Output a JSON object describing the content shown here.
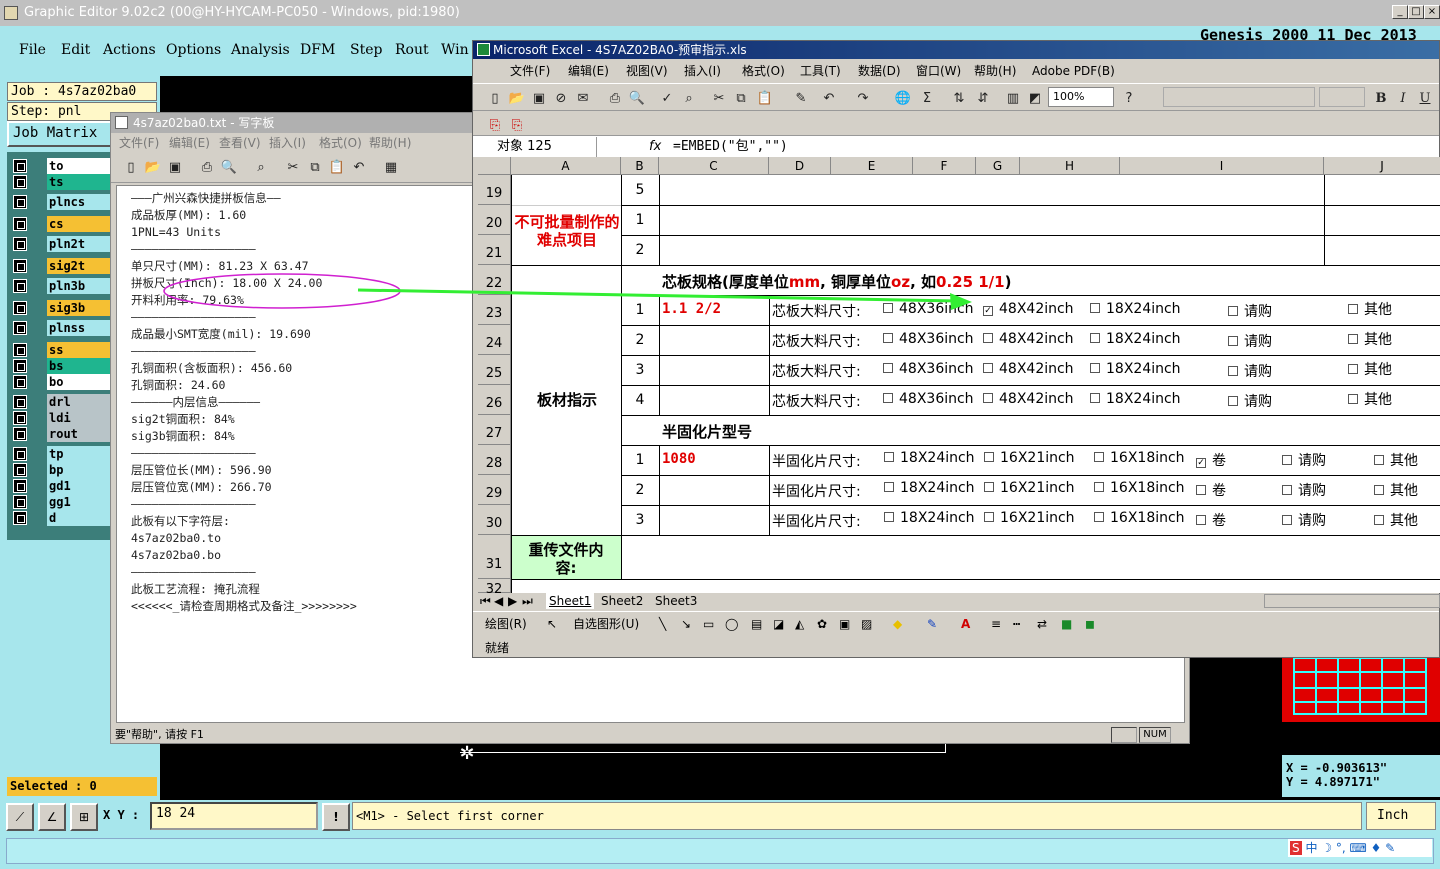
{
  "ge": {
    "title": "Graphic Editor 9.02c2 (00@HY-HYCAM-PC050 - Windows, pid:1980)",
    "menu": [
      "File",
      "Edit",
      "Actions",
      "Options",
      "Analysis",
      "DFM",
      "Step",
      "Rout",
      "Win"
    ],
    "job": "Job : 4s7az02ba0",
    "step": "Step: pnl",
    "job_matrix": "Job Matrix",
    "layers": [
      {
        "name": "to",
        "color": "#ffffff"
      },
      {
        "name": "ts",
        "color": "#1fb58f"
      },
      {
        "name": "plncs",
        "color": "#a7e6ec"
      },
      {
        "name": "cs",
        "color": "#f5c033"
      },
      {
        "name": "pln2t",
        "color": "#a7e6ec"
      },
      {
        "name": "sig2t",
        "color": "#f5c033"
      },
      {
        "name": "pln3b",
        "color": "#a7e6ec"
      },
      {
        "name": "sig3b",
        "color": "#f5c033"
      },
      {
        "name": "plnss",
        "color": "#a7e6ec"
      },
      {
        "name": "ss",
        "color": "#f5c033"
      },
      {
        "name": "bs",
        "color": "#1fb58f"
      },
      {
        "name": "bo",
        "color": "#ffffff"
      },
      {
        "name": "drl",
        "color": "#b8c4c8"
      },
      {
        "name": "ldi",
        "color": "#b8c4c8"
      },
      {
        "name": "rout",
        "color": "#b8c4c8"
      },
      {
        "name": "tp",
        "color": "#a7e6ec"
      },
      {
        "name": "bp",
        "color": "#a7e6ec"
      },
      {
        "name": "gd1",
        "color": "#a7e6ec"
      },
      {
        "name": "gg1",
        "color": "#a7e6ec"
      },
      {
        "name": "d",
        "color": "#a7e6ec"
      }
    ],
    "selected": "Selected : 0",
    "xy_label": "X Y :",
    "xy_value": "18 24",
    "status_message": "<M1> - Select first corner",
    "units": "Inch",
    "coord_x": "X = -0.903613\"",
    "coord_y": "Y = 4.897171\"",
    "header_partial": "Genesis 2000 11 Dec 2013"
  },
  "notepad": {
    "title": "4s7az02ba0.txt - 写字板",
    "menu": [
      "文件(F)",
      "编辑(E)",
      "查看(V)",
      "插入(I)",
      "格式(O)",
      "帮助(H)"
    ],
    "lines": [
      "———广州兴森快捷拼板信息——",
      "成品板厚(MM): 1.60",
      "1PNL=43 Units",
      "——————————————————",
      "单只尺寸(MM): 81.23 X 63.47",
      "拼板尺寸(Inch): 18.00 X 24.00",
      "开料利用率: 79.63%",
      "——————————————————",
      "成品最小SMT宽度(mil): 19.690",
      "——————————————————",
      "孔铜面积(含板面积): 456.60",
      "孔铜面积: 24.60",
      "——————内层信息——————",
      "sig2t铜面积: 84%",
      "sig3b铜面积: 84%",
      "——————————————————",
      "层压管位长(MM): 596.90",
      "层压管位宽(MM): 266.70",
      "——————————————————",
      "此板有以下字符层:",
      "4s7az02ba0.to",
      "4s7az02ba0.bo",
      "——————————————————",
      "此板工艺流程: 掩孔流程",
      "<<<<<<_请检查周期格式及备注_>>>>>>>>"
    ],
    "status": "要\"帮助\", 请按 F1"
  },
  "excel": {
    "title": "Microsoft Excel - 4S7AZ02BA0-预审指示.xls",
    "menu": [
      "文件(F)",
      "编辑(E)",
      "视图(V)",
      "插入(I)",
      "格式(O)",
      "工具(T)",
      "数据(D)",
      "窗口(W)",
      "帮助(H)",
      "Adobe PDF(B)"
    ],
    "zoom": "100%",
    "name_box": "对象 125",
    "formula": "=EMBED(\"包\",\"\")",
    "columns": [
      "A",
      "B",
      "C",
      "D",
      "E",
      "F",
      "G",
      "H",
      "I",
      "J"
    ],
    "rows": [
      "19",
      "20",
      "21",
      "22",
      "23",
      "24",
      "25",
      "26",
      "27",
      "28",
      "29",
      "30",
      "31",
      "32"
    ],
    "b_values": {
      "r19": "5",
      "r20": "1",
      "r21": "2",
      "r23": "1",
      "r24": "2",
      "r25": "3",
      "r26": "4",
      "r28": "1",
      "r29": "2",
      "r30": "3"
    },
    "difficulty_label": "不可批量制作的难点项目",
    "board_label": "板材指示",
    "resend_label": "重传文件内容:",
    "core_header_a": "芯板规格(厚度单位",
    "core_header_mm": "mm",
    "core_header_b": ", 铜厚单位",
    "core_header_oz": "oz",
    "core_header_c": ", 如",
    "core_header_eg": "0.25 1/1",
    "core_header_d": ")",
    "core_value": "1.1 2/2",
    "core_label": "芯板大料尺寸:",
    "core_opts": [
      "48X36inch",
      "48X42inch",
      "18X24inch",
      "请购",
      "其他"
    ],
    "prepreg_header": "半固化片型号",
    "prepreg_value": "1080",
    "prepreg_label": "半固化片尺寸:",
    "prepreg_opts": [
      "18X24inch",
      "16X21inch",
      "16X18inch",
      "卷",
      "请购",
      "其他"
    ],
    "sheets": [
      "Sheet1",
      "Sheet2",
      "Sheet3"
    ],
    "draw_label": "绘图(R)",
    "autoshape_label": "自选图形(U)",
    "status": "就绪",
    "num": "NUM",
    "check_mark": "✓"
  }
}
